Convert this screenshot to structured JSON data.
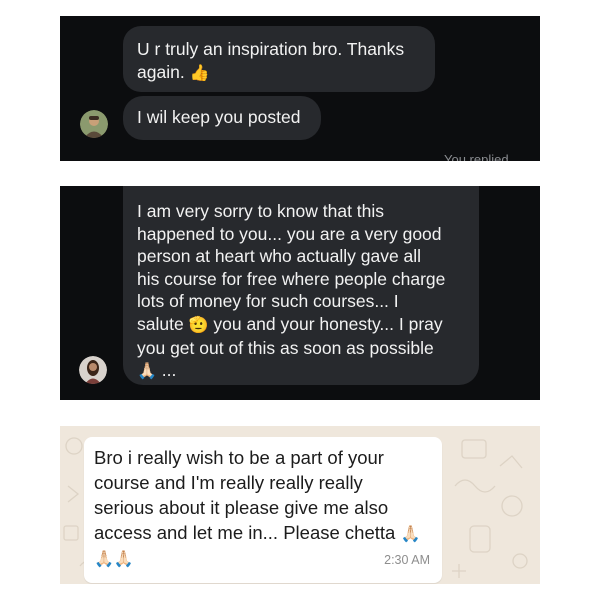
{
  "screenshot_1": {
    "messages": [
      {
        "line1": "U r truly an inspiration bro. Thanks",
        "line2": "again.",
        "emoji": "👍"
      },
      {
        "text": "I wil keep you posted"
      }
    ],
    "cut_off_text": "You replied",
    "avatar": "avatar-icon"
  },
  "screenshot_2": {
    "lines": [
      "I am very sorry to know that this",
      "happened to you... you are a very good",
      "person at heart who actually gave all",
      "his course for free where people charge",
      "lots of money for such courses... I"
    ],
    "line6_before": "salute",
    "line6_emoji": "🫡",
    "line6_after": " you and your honesty... I pray",
    "line7": "you get out of this as soon as possible",
    "line8_emoji": "🙏🏻",
    "line8_after": "...",
    "avatar": "avatar-icon"
  },
  "screenshot_3": {
    "lines": [
      "Bro i really wish to be a part of your",
      "course and I'm really really really",
      "serious about it please give me also",
      "access and let me in... Please chetta"
    ],
    "line4_emoji": "🙏🏻",
    "line5_emoji": "🙏🏻🙏🏻",
    "time": "2:30 AM"
  },
  "colors": {
    "dark_bg": "#0c0d0f",
    "dark_bubble": "#27292d",
    "whatsapp_bg": "#efe7dc",
    "whatsapp_bubble": "#ffffff"
  }
}
